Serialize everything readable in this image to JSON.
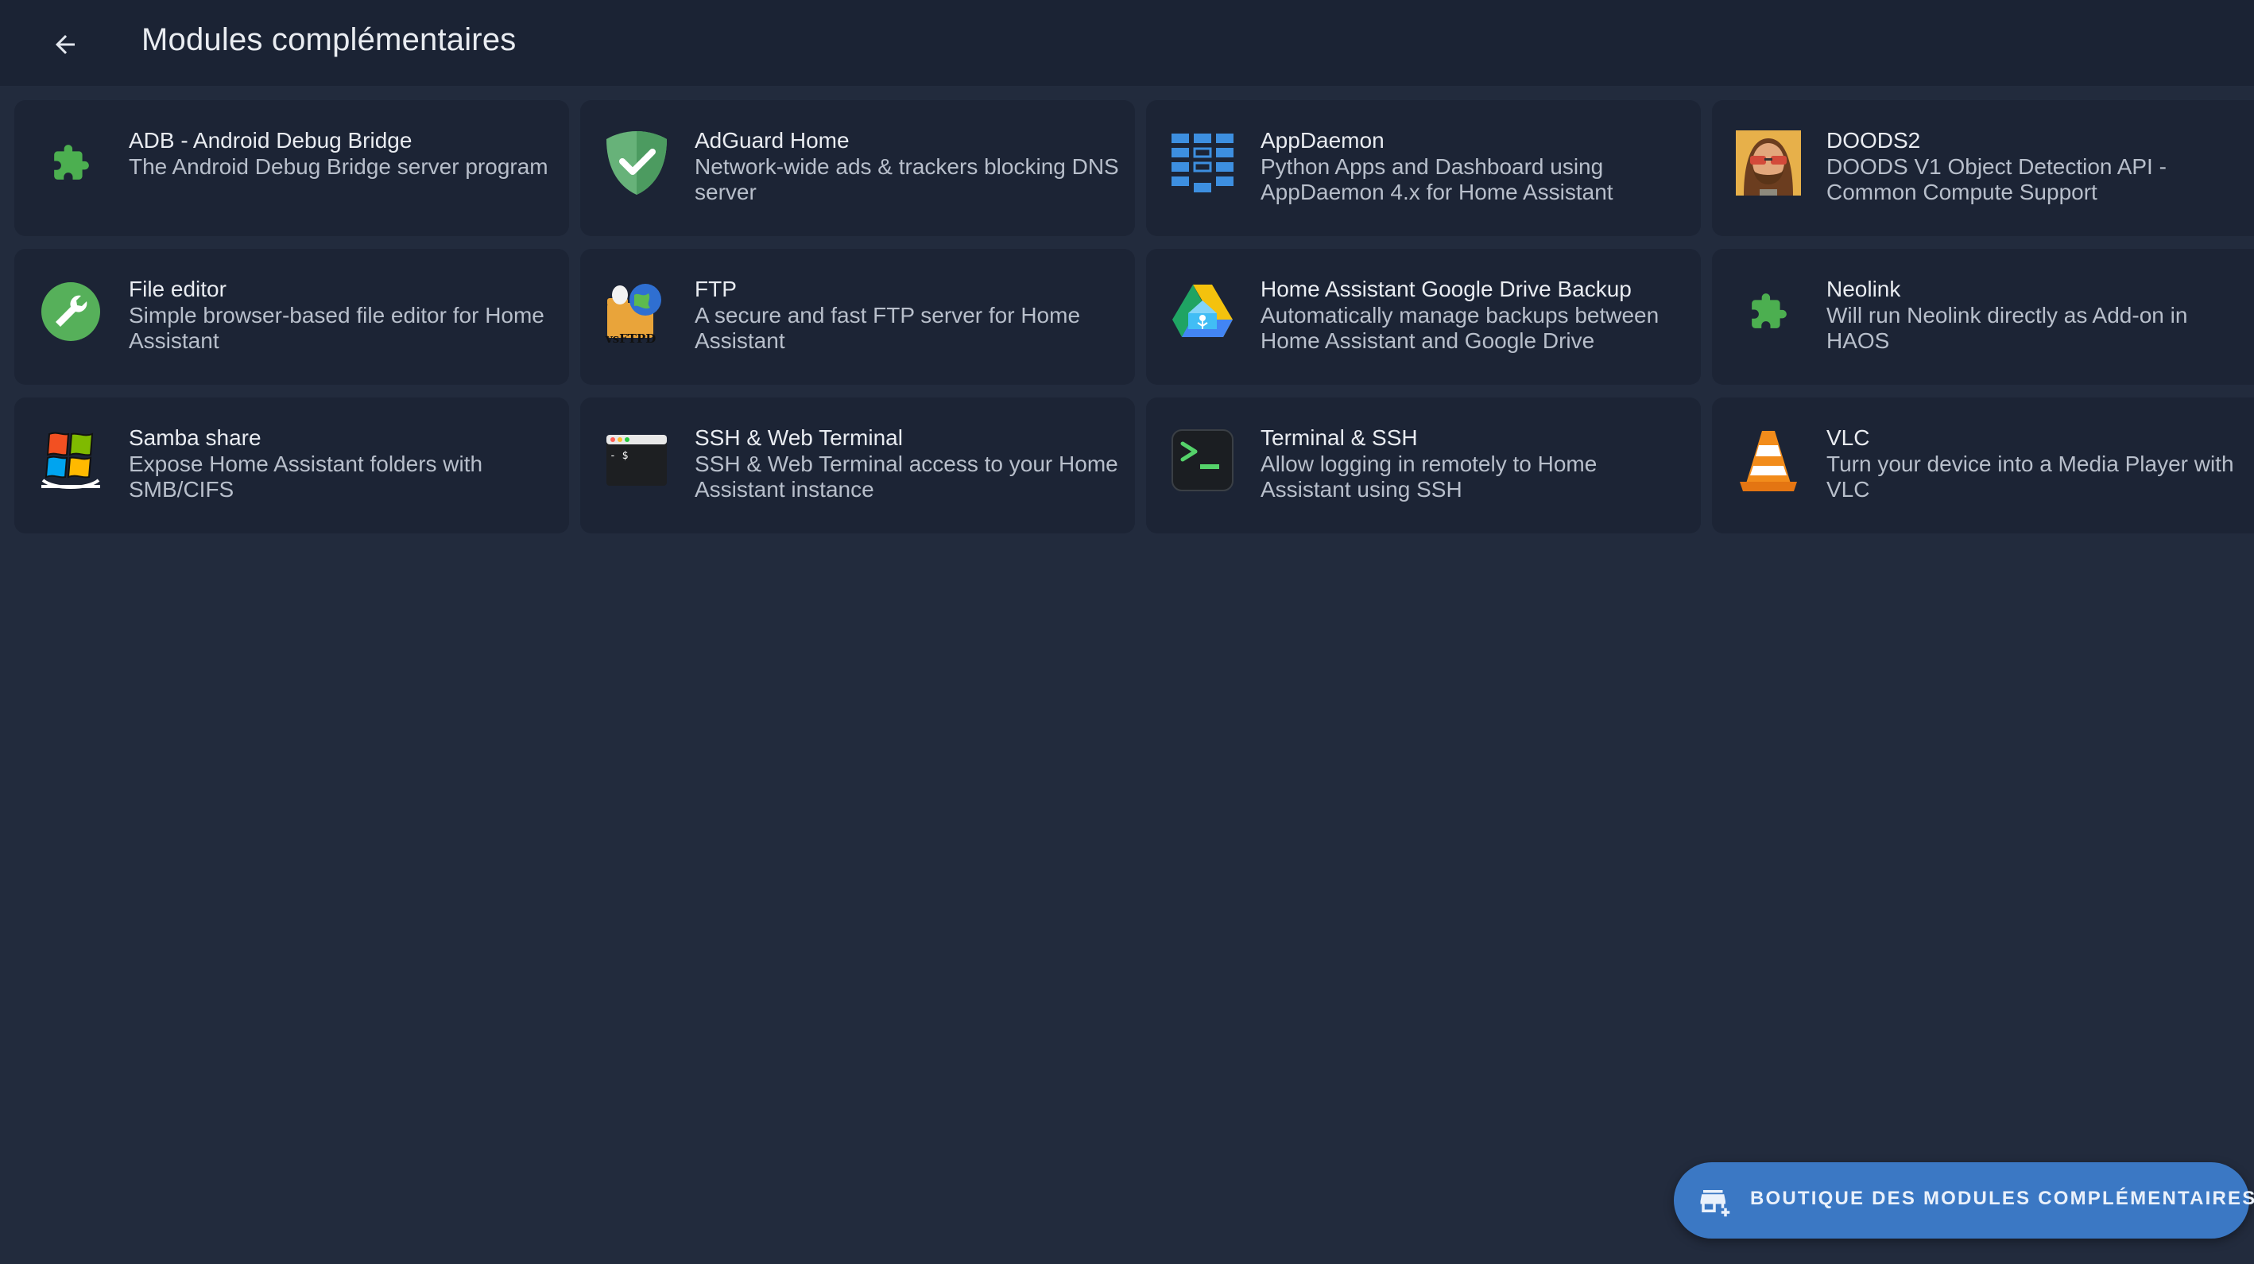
{
  "header": {
    "title": "Modules complémentaires"
  },
  "addons": [
    {
      "name": "ADB - Android Debug Bridge",
      "description": "The Android Debug Bridge server program",
      "icon": "puzzle-icon"
    },
    {
      "name": "AdGuard Home",
      "description": "Network-wide ads & trackers blocking DNS server",
      "icon": "adguard-shield-icon"
    },
    {
      "name": "AppDaemon",
      "description": "Python Apps and Dashboard using AppDaemon 4.x for Home Assistant",
      "icon": "appdaemon-icon"
    },
    {
      "name": "DOODS2",
      "description": "DOODS V1 Object Detection API - Common Compute Support",
      "icon": "doods-avatar-icon"
    },
    {
      "name": "File editor",
      "description": "Simple browser-based file editor for Home Assistant",
      "icon": "wrench-icon"
    },
    {
      "name": "FTP",
      "description": "A secure and fast FTP server for Home Assistant",
      "icon": "vsftpd-icon"
    },
    {
      "name": "Home Assistant Google Drive Backup",
      "description": "Automatically manage backups between Home Assistant and Google Drive",
      "icon": "google-drive-backup-icon"
    },
    {
      "name": "Neolink",
      "description": "Will run Neolink directly as Add-on in HAOS",
      "icon": "puzzle-icon"
    },
    {
      "name": "Samba share",
      "description": "Expose Home Assistant folders with SMB/CIFS",
      "icon": "windows-share-icon"
    },
    {
      "name": "SSH & Web Terminal",
      "description": "SSH & Web Terminal access to your Home Assistant instance",
      "icon": "web-terminal-icon"
    },
    {
      "name": "Terminal & SSH",
      "description": "Allow logging in remotely to Home Assistant using SSH",
      "icon": "terminal-icon"
    },
    {
      "name": "VLC",
      "description": "Turn your device into a Media Player with VLC",
      "icon": "vlc-cone-icon"
    }
  ],
  "store_button": {
    "label": "BOUTIQUE DES MODULES COMPLÉMENTAIRES",
    "icon": "store-plus-icon"
  },
  "colors": {
    "background": "#222b3d",
    "card": "#1c2435",
    "accent": "#3b78c4",
    "green": "#4caf50"
  }
}
